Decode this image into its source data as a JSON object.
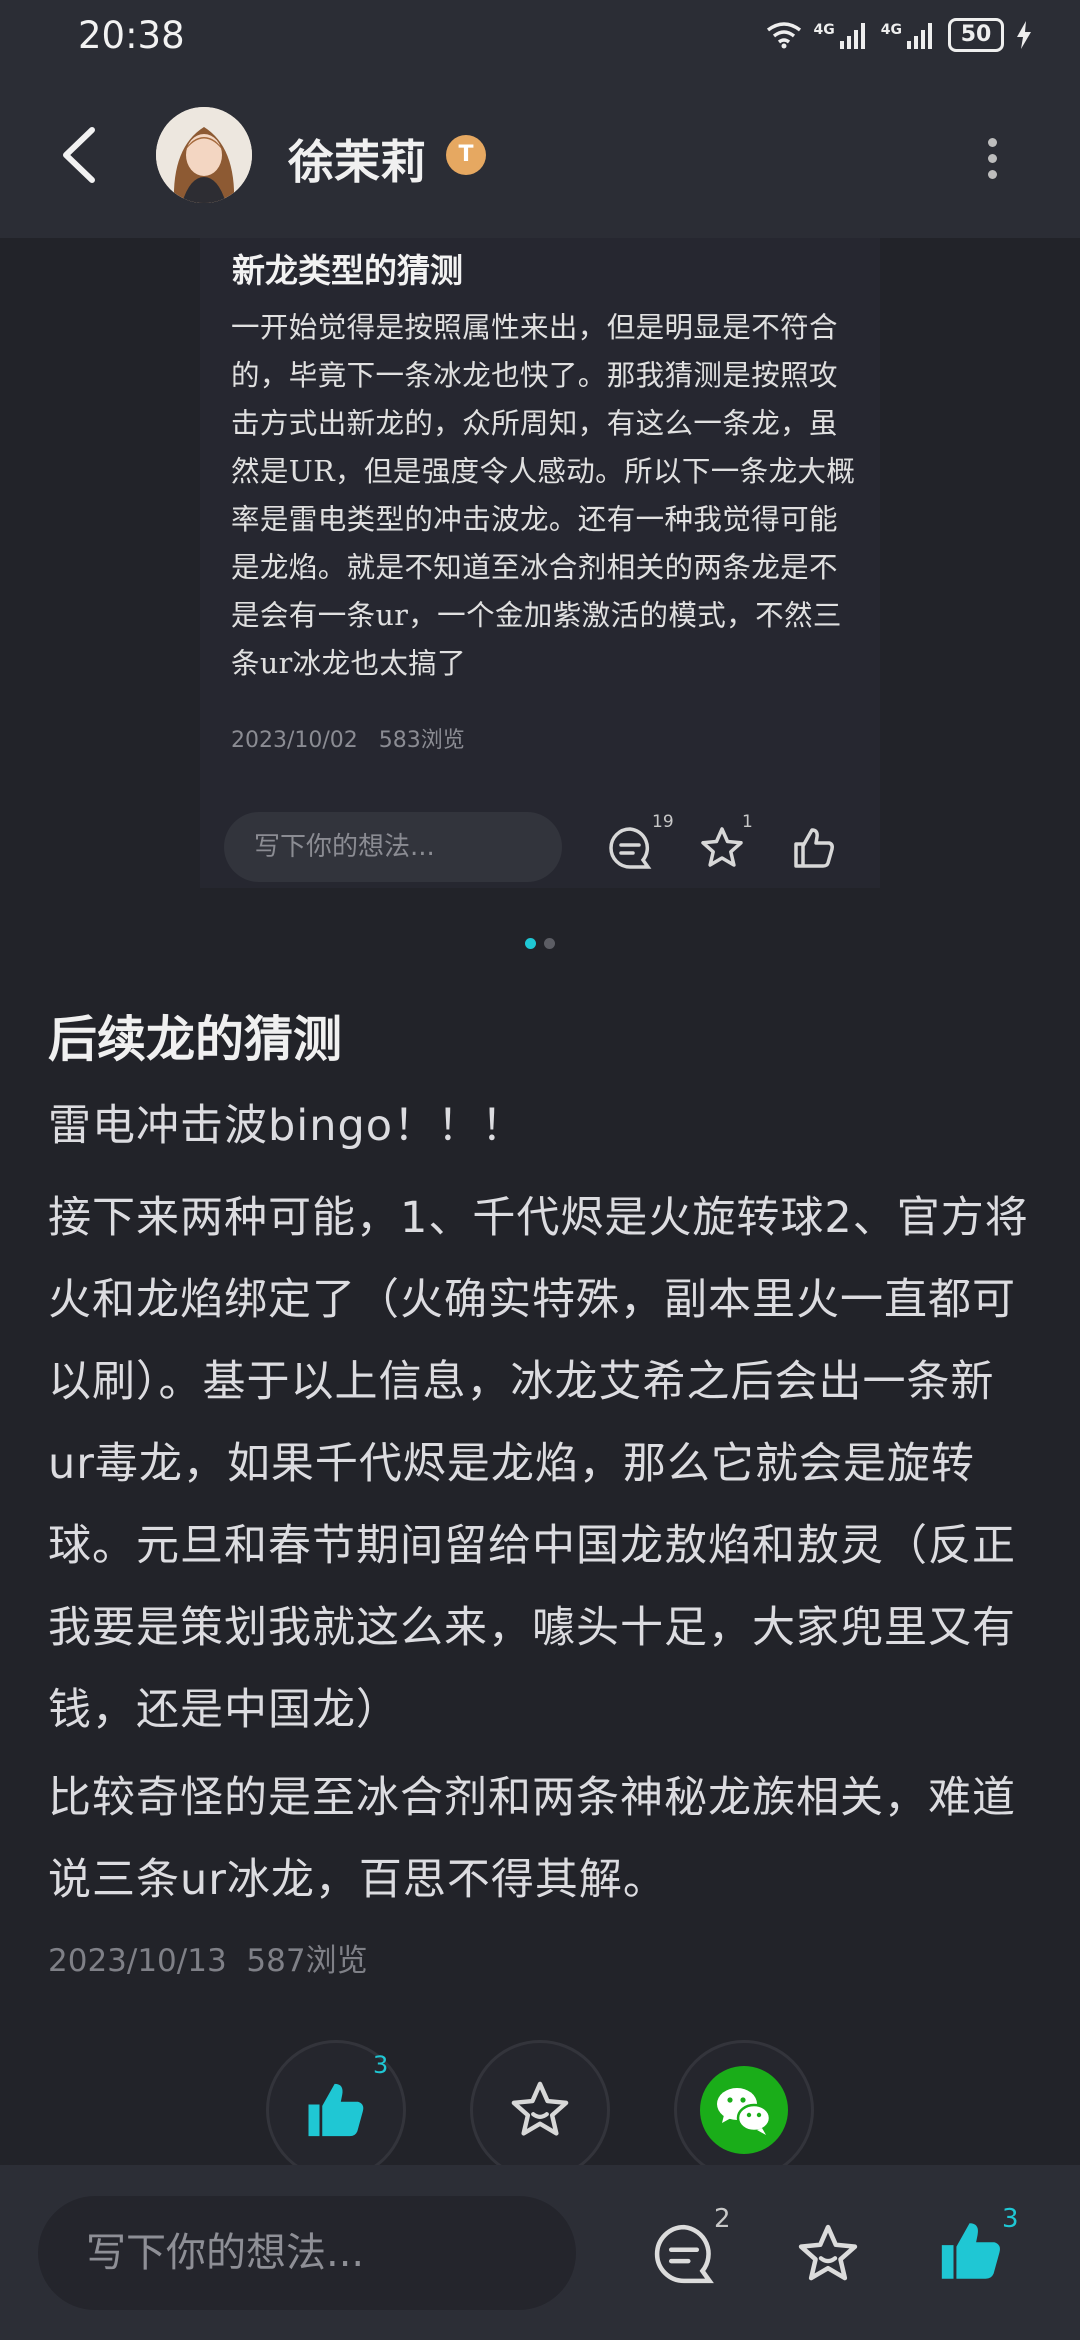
{
  "status": {
    "time": "20:38",
    "signal1": "4G",
    "signal2": "4G",
    "battery": "50"
  },
  "header": {
    "username": "徐茉莉",
    "badge": "T"
  },
  "embed": {
    "title": "新龙类型的猜测",
    "body": "一开始觉得是按照属性来出，但是明显是不符合的，毕竟下一条冰龙也快了。那我猜测是按照攻击方式出新龙的，众所周知，有这么一条龙，虽然是UR，但是强度令人感动。所以下一条龙大概率是雷电类型的冲击波龙。还有一种我觉得可能是龙焰。就是不知道至冰合剂相关的两条龙是不是会有一条ur，一个金加紫激活的模式，不然三条ur冰龙也太搞了",
    "date": "2023/10/02",
    "views": "583浏览",
    "comment_placeholder": "写下你的想法...",
    "comment_count": "19",
    "star_count": "1"
  },
  "post": {
    "title": "后续龙的猜测",
    "paragraphs": [
      "雷电冲击波bingo！！！",
      "接下来两种可能，1、千代烬是火旋转球2、官方将火和龙焰绑定了（火确实特殊，副本里火一直都可以刷）。基于以上信息，冰龙艾希之后会出一条新ur毒龙，如果千代烬是龙焰，那么它就会是旋转球。元旦和春节期间留给中国龙敖焰和敖灵（反正我要是策划我就这么来，噱头十足，大家兜里又有钱，还是中国龙）",
      "比较奇怪的是至冰合剂和两条神秘龙族相关，难道说三条ur冰龙，百思不得其解。"
    ],
    "date": "2023/10/13",
    "views": "587浏览",
    "like_count": "3"
  },
  "bottom": {
    "placeholder": "写下你的想法...",
    "comment_count": "2",
    "like_count": "3"
  },
  "colors": {
    "accent": "#1fc7d4",
    "wechat": "#1aad19",
    "badge": "#e6a861"
  }
}
